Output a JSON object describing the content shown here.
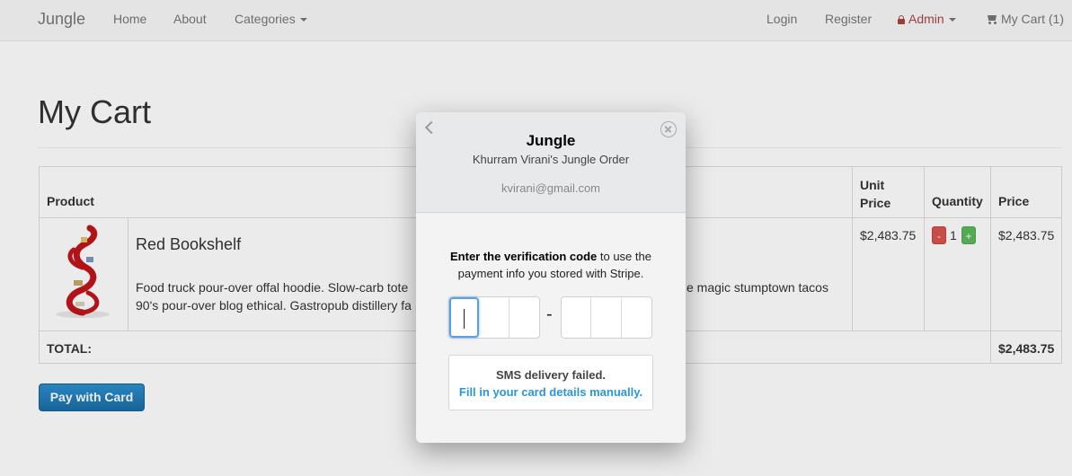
{
  "navbar": {
    "brand": "Jungle",
    "home": "Home",
    "about": "About",
    "categories": "Categories",
    "login": "Login",
    "register": "Register",
    "admin": "Admin",
    "cart": "My Cart (1)"
  },
  "page": {
    "title": "My Cart"
  },
  "table": {
    "headers": {
      "product": "Product",
      "unit_price": "Unit Price",
      "quantity": "Quantity",
      "price": "Price"
    },
    "rows": [
      {
        "name": "Red Bookshelf",
        "description_line1": "Food truck pour-over offal hoodie. Slow-carb tote",
        "description_line1_tail": "e magic stumptown tacos",
        "description_line2": "90's pour-over blog ethical. Gastropub distillery fa",
        "unit_price": "$2,483.75",
        "quantity": "1",
        "minus": "-",
        "plus": "+",
        "price": "$2,483.75"
      }
    ],
    "total_label": "TOTAL:",
    "total_value": "$2,483.75"
  },
  "pay_button": "Pay with Card",
  "modal": {
    "title": "Jungle",
    "subtitle": "Khurram Virani's Jungle Order",
    "email": "kvirani@gmail.com",
    "verify_bold": "Enter the verification code",
    "verify_rest": " to use the payment info you stored with Stripe.",
    "dash": "-",
    "sms_failed": "SMS delivery failed.",
    "manual_link": "Fill in your card details manually."
  },
  "colors": {
    "pay_button": "#1f7dbd",
    "admin": "#a94442",
    "qty_minus": "#d9534f",
    "qty_plus": "#5cb85c",
    "link": "#2a96d6"
  }
}
